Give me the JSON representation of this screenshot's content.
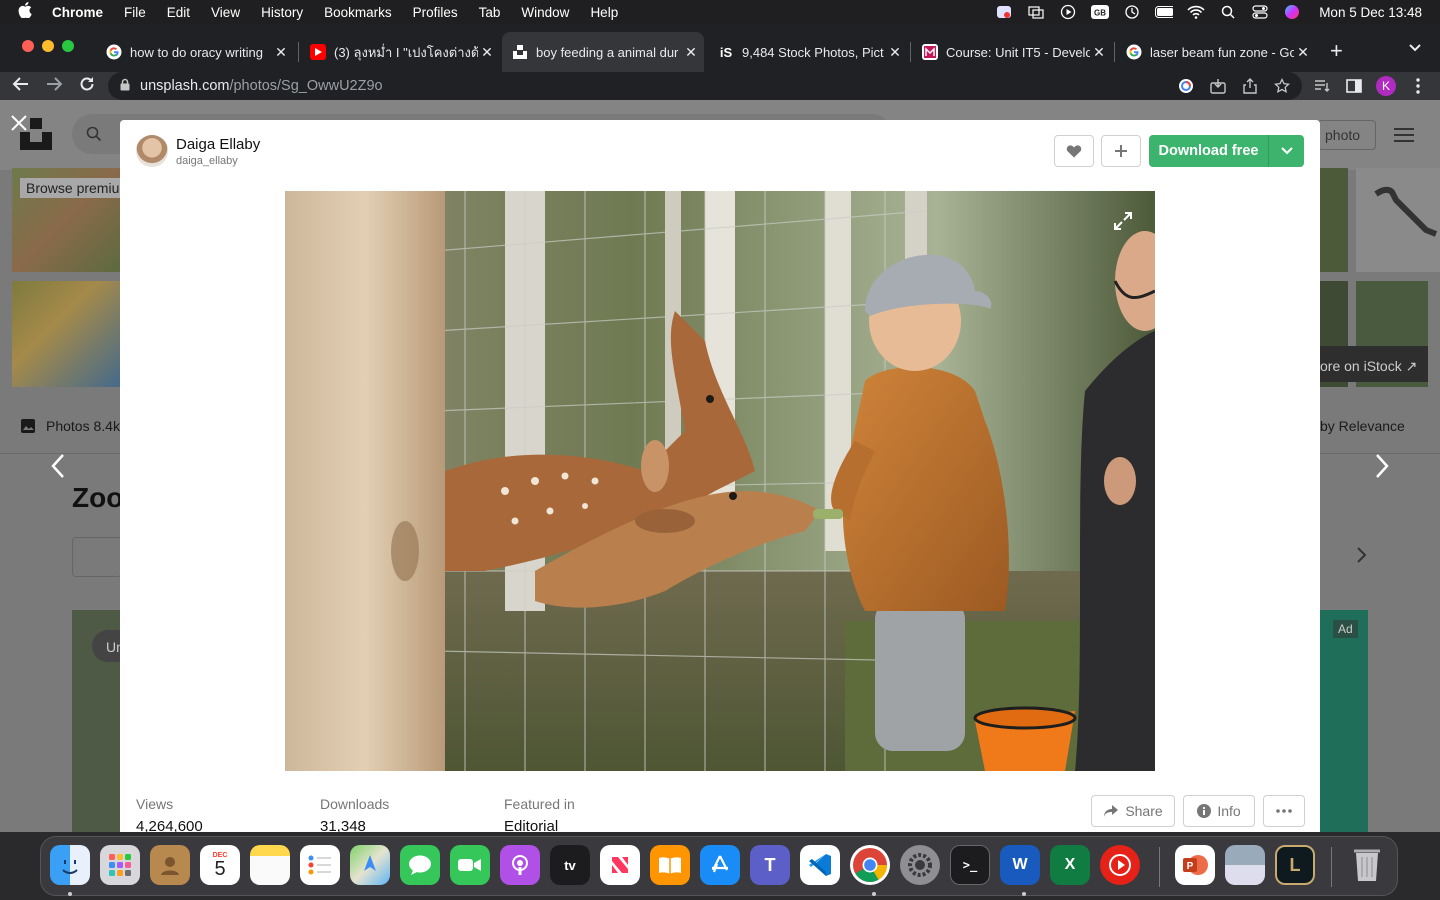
{
  "menubar": {
    "app": "Chrome",
    "items": [
      "File",
      "Edit",
      "View",
      "History",
      "Bookmarks",
      "Profiles",
      "Tab",
      "Window",
      "Help"
    ],
    "clock": "Mon 5 Dec  13:48"
  },
  "tabs": [
    {
      "title": "how to do oracy writing",
      "favicon": "google-icon",
      "active": false
    },
    {
      "title": "(3) ลุงหม่ำ I \"เปงโคงต่างด้า",
      "favicon": "youtube-icon",
      "active": false
    },
    {
      "title": "boy feeding a animal dur",
      "favicon": "unsplash-icon",
      "active": true
    },
    {
      "title": "9,484 Stock Photos, Pict",
      "favicon": "istock-icon",
      "active": false
    },
    {
      "title": "Course: Unit IT5 - Develo",
      "favicon": "moodle-icon",
      "active": false
    },
    {
      "title": "laser beam fun zone - Go",
      "favicon": "google-icon",
      "active": false
    }
  ],
  "address": {
    "host": "unsplash.com",
    "path": "/photos/Sg_OwwU2Z9o"
  },
  "profile_initial": "K",
  "background": {
    "browse_premium": "Browse premiu",
    "photos_tab": "Photos 8.4k",
    "heading": "Zoo",
    "relevance": "by Relevance",
    "more_istock": "ore on iStock ↗",
    "submit_photo": "photo",
    "ad": "Ad",
    "un": "Un"
  },
  "modal": {
    "author_name": "Daiga Ellaby",
    "author_handle": "daiga_ellaby",
    "download_label": "Download free",
    "photo_alt": "boy feeding a animal",
    "stats": [
      {
        "label": "Views",
        "value": "4,264,600"
      },
      {
        "label": "Downloads",
        "value": "31,348"
      },
      {
        "label": "Featured in",
        "value": "Editorial"
      }
    ],
    "share_label": "Share",
    "info_label": "Info"
  },
  "dock": {
    "calendar_month": "DEC",
    "calendar_day": "5",
    "apps": [
      "finder",
      "launchpad",
      "contacts",
      "calendar",
      "notes",
      "reminders",
      "maps",
      "messages",
      "facetime",
      "podcasts",
      "tv",
      "news",
      "books",
      "app-store",
      "teams",
      "vscode",
      "chrome",
      "system-settings",
      "terminal",
      "word",
      "excel",
      "youtube-player",
      "powerpoint",
      "preview",
      "league",
      "trash"
    ]
  }
}
